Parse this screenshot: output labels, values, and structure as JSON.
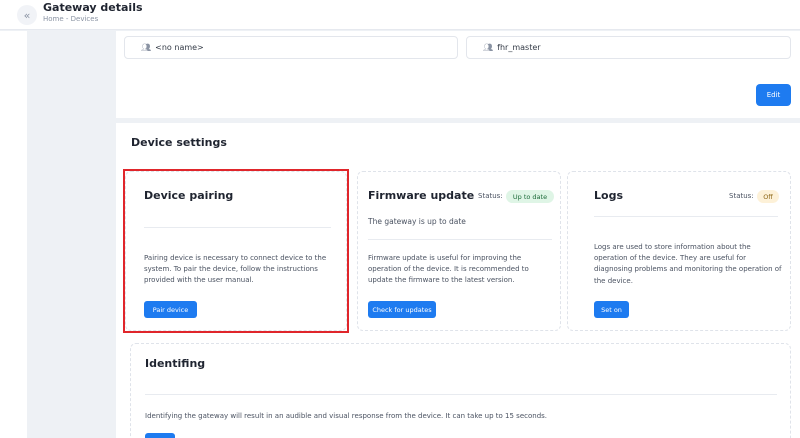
{
  "header": {
    "back_icon": "chevron-left-icon",
    "title": "Gateway details",
    "breadcrumb": "Home - Devices"
  },
  "names": {
    "icon": "people-icon",
    "field1_value": "<no name>",
    "field2_value": "fhr_master"
  },
  "edit_label": "Edit",
  "settings": {
    "title": "Device settings",
    "pairing": {
      "title": "Device pairing",
      "description": "Pairing device is necessary to connect device to the system. To pair the device, follow the instructions provided with the user manual.",
      "button": "Pair device"
    },
    "firmware": {
      "title": "Firmware update",
      "status_label": "Status:",
      "status_value": "Up to date",
      "subtitle": "The gateway is up to date",
      "description": "Firmware update is useful for improving the operation of the device. It is recommended to update the firmware to the latest version.",
      "button": "Check for updates"
    },
    "logs": {
      "title": "Logs",
      "status_label": "Status:",
      "status_value": "Off",
      "description": "Logs are used to store information about the operation of the device. They are useful for diagnosing problems and monitoring the operation of the device.",
      "button": "Set on"
    },
    "identifying": {
      "title": "Identifing",
      "description": "Identifying the gateway will result in an audible and visual response from the device. It can take up to 15 seconds."
    }
  },
  "colors": {
    "primary": "#1e7bf0",
    "highlight": "#e0262b",
    "status_ok_bg": "#dff5e6",
    "status_off_bg": "#fdf1d8"
  }
}
